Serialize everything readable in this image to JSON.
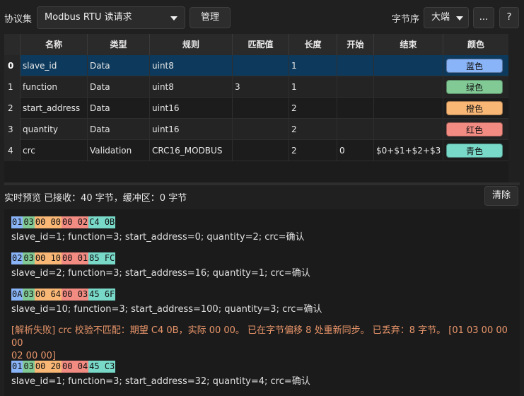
{
  "toolbar": {
    "protocol_label": "协议集",
    "protocol_value": "Modbus RTU 读请求",
    "manage_label": "管理",
    "byte_order_label": "字节序",
    "byte_order_value": "大端",
    "more_label": "...",
    "help_label": "?"
  },
  "table": {
    "columns": [
      "名称",
      "类型",
      "规则",
      "匹配值",
      "长度",
      "开始",
      "结束",
      "颜色"
    ],
    "rows": [
      {
        "idx": "0",
        "name": "slave_id",
        "type": "Data",
        "rule": "uint8",
        "match": "",
        "length": "1",
        "start": "",
        "end": "",
        "color_name": "蓝色",
        "color": "#8ab4f8"
      },
      {
        "idx": "1",
        "name": "function",
        "type": "Data",
        "rule": "uint8",
        "match": "3",
        "length": "1",
        "start": "",
        "end": "",
        "color_name": "绿色",
        "color": "#81c995"
      },
      {
        "idx": "2",
        "name": "start_address",
        "type": "Data",
        "rule": "uint16",
        "match": "",
        "length": "2",
        "start": "",
        "end": "",
        "color_name": "橙色",
        "color": "#f9b776"
      },
      {
        "idx": "3",
        "name": "quantity",
        "type": "Data",
        "rule": "uint16",
        "match": "",
        "length": "2",
        "start": "",
        "end": "",
        "color_name": "红色",
        "color": "#f28b82"
      },
      {
        "idx": "4",
        "name": "crc",
        "type": "Validation",
        "rule": "CRC16_MODBUS",
        "match": "",
        "length": "2",
        "start": "0",
        "end": "$0+$1+$2+$3",
        "color_name": "青色",
        "color": "#78d9c9"
      }
    ]
  },
  "status": {
    "text": "实时预览 已接收：40 字节，缓冲区：0 字节",
    "clear_label": "清除"
  },
  "log": {
    "frames": [
      {
        "bytes": [
          {
            "t": "01",
            "c": "#8ab4f8"
          },
          {
            "t": "03",
            "c": "#81c995"
          },
          {
            "t": "00 00",
            "c": "#f9b776"
          },
          {
            "t": "00 02",
            "c": "#f28b82"
          },
          {
            "t": "C4 0B",
            "c": "#78d9c9"
          }
        ],
        "decoded": "slave_id=1; function=3; start_address=0; quantity=2; crc=确认"
      },
      {
        "bytes": [
          {
            "t": "02",
            "c": "#8ab4f8"
          },
          {
            "t": "03",
            "c": "#81c995"
          },
          {
            "t": "00 10",
            "c": "#f9b776"
          },
          {
            "t": "00 01",
            "c": "#f28b82"
          },
          {
            "t": "85 FC",
            "c": "#78d9c9"
          }
        ],
        "decoded": "slave_id=2; function=3; start_address=16; quantity=1; crc=确认"
      },
      {
        "bytes": [
          {
            "t": "0A",
            "c": "#8ab4f8"
          },
          {
            "t": "03",
            "c": "#81c995"
          },
          {
            "t": "00 64",
            "c": "#f9b776"
          },
          {
            "t": "00 03",
            "c": "#f28b82"
          },
          {
            "t": "45 6F",
            "c": "#78d9c9"
          }
        ],
        "decoded": "slave_id=10; function=3; start_address=100; quantity=3; crc=确认"
      },
      {
        "bytes": [
          {
            "t": "01",
            "c": "#8ab4f8"
          },
          {
            "t": "03",
            "c": "#81c995"
          },
          {
            "t": "00 20",
            "c": "#f9b776"
          },
          {
            "t": "00 04",
            "c": "#f28b82"
          },
          {
            "t": "45 C3",
            "c": "#78d9c9"
          }
        ],
        "decoded": "slave_id=1; function=3; start_address=32; quantity=4; crc=确认"
      }
    ],
    "error_line1": "[解析失败] crc 校验不匹配：期望 C4 0B，实际 00 00。 已在字节偏移 8 处重新同步。 已丢弃：8 字节。 [01 03 00 00 00",
    "error_line2": "02 00 00]",
    "error_color": "#e8956a"
  }
}
